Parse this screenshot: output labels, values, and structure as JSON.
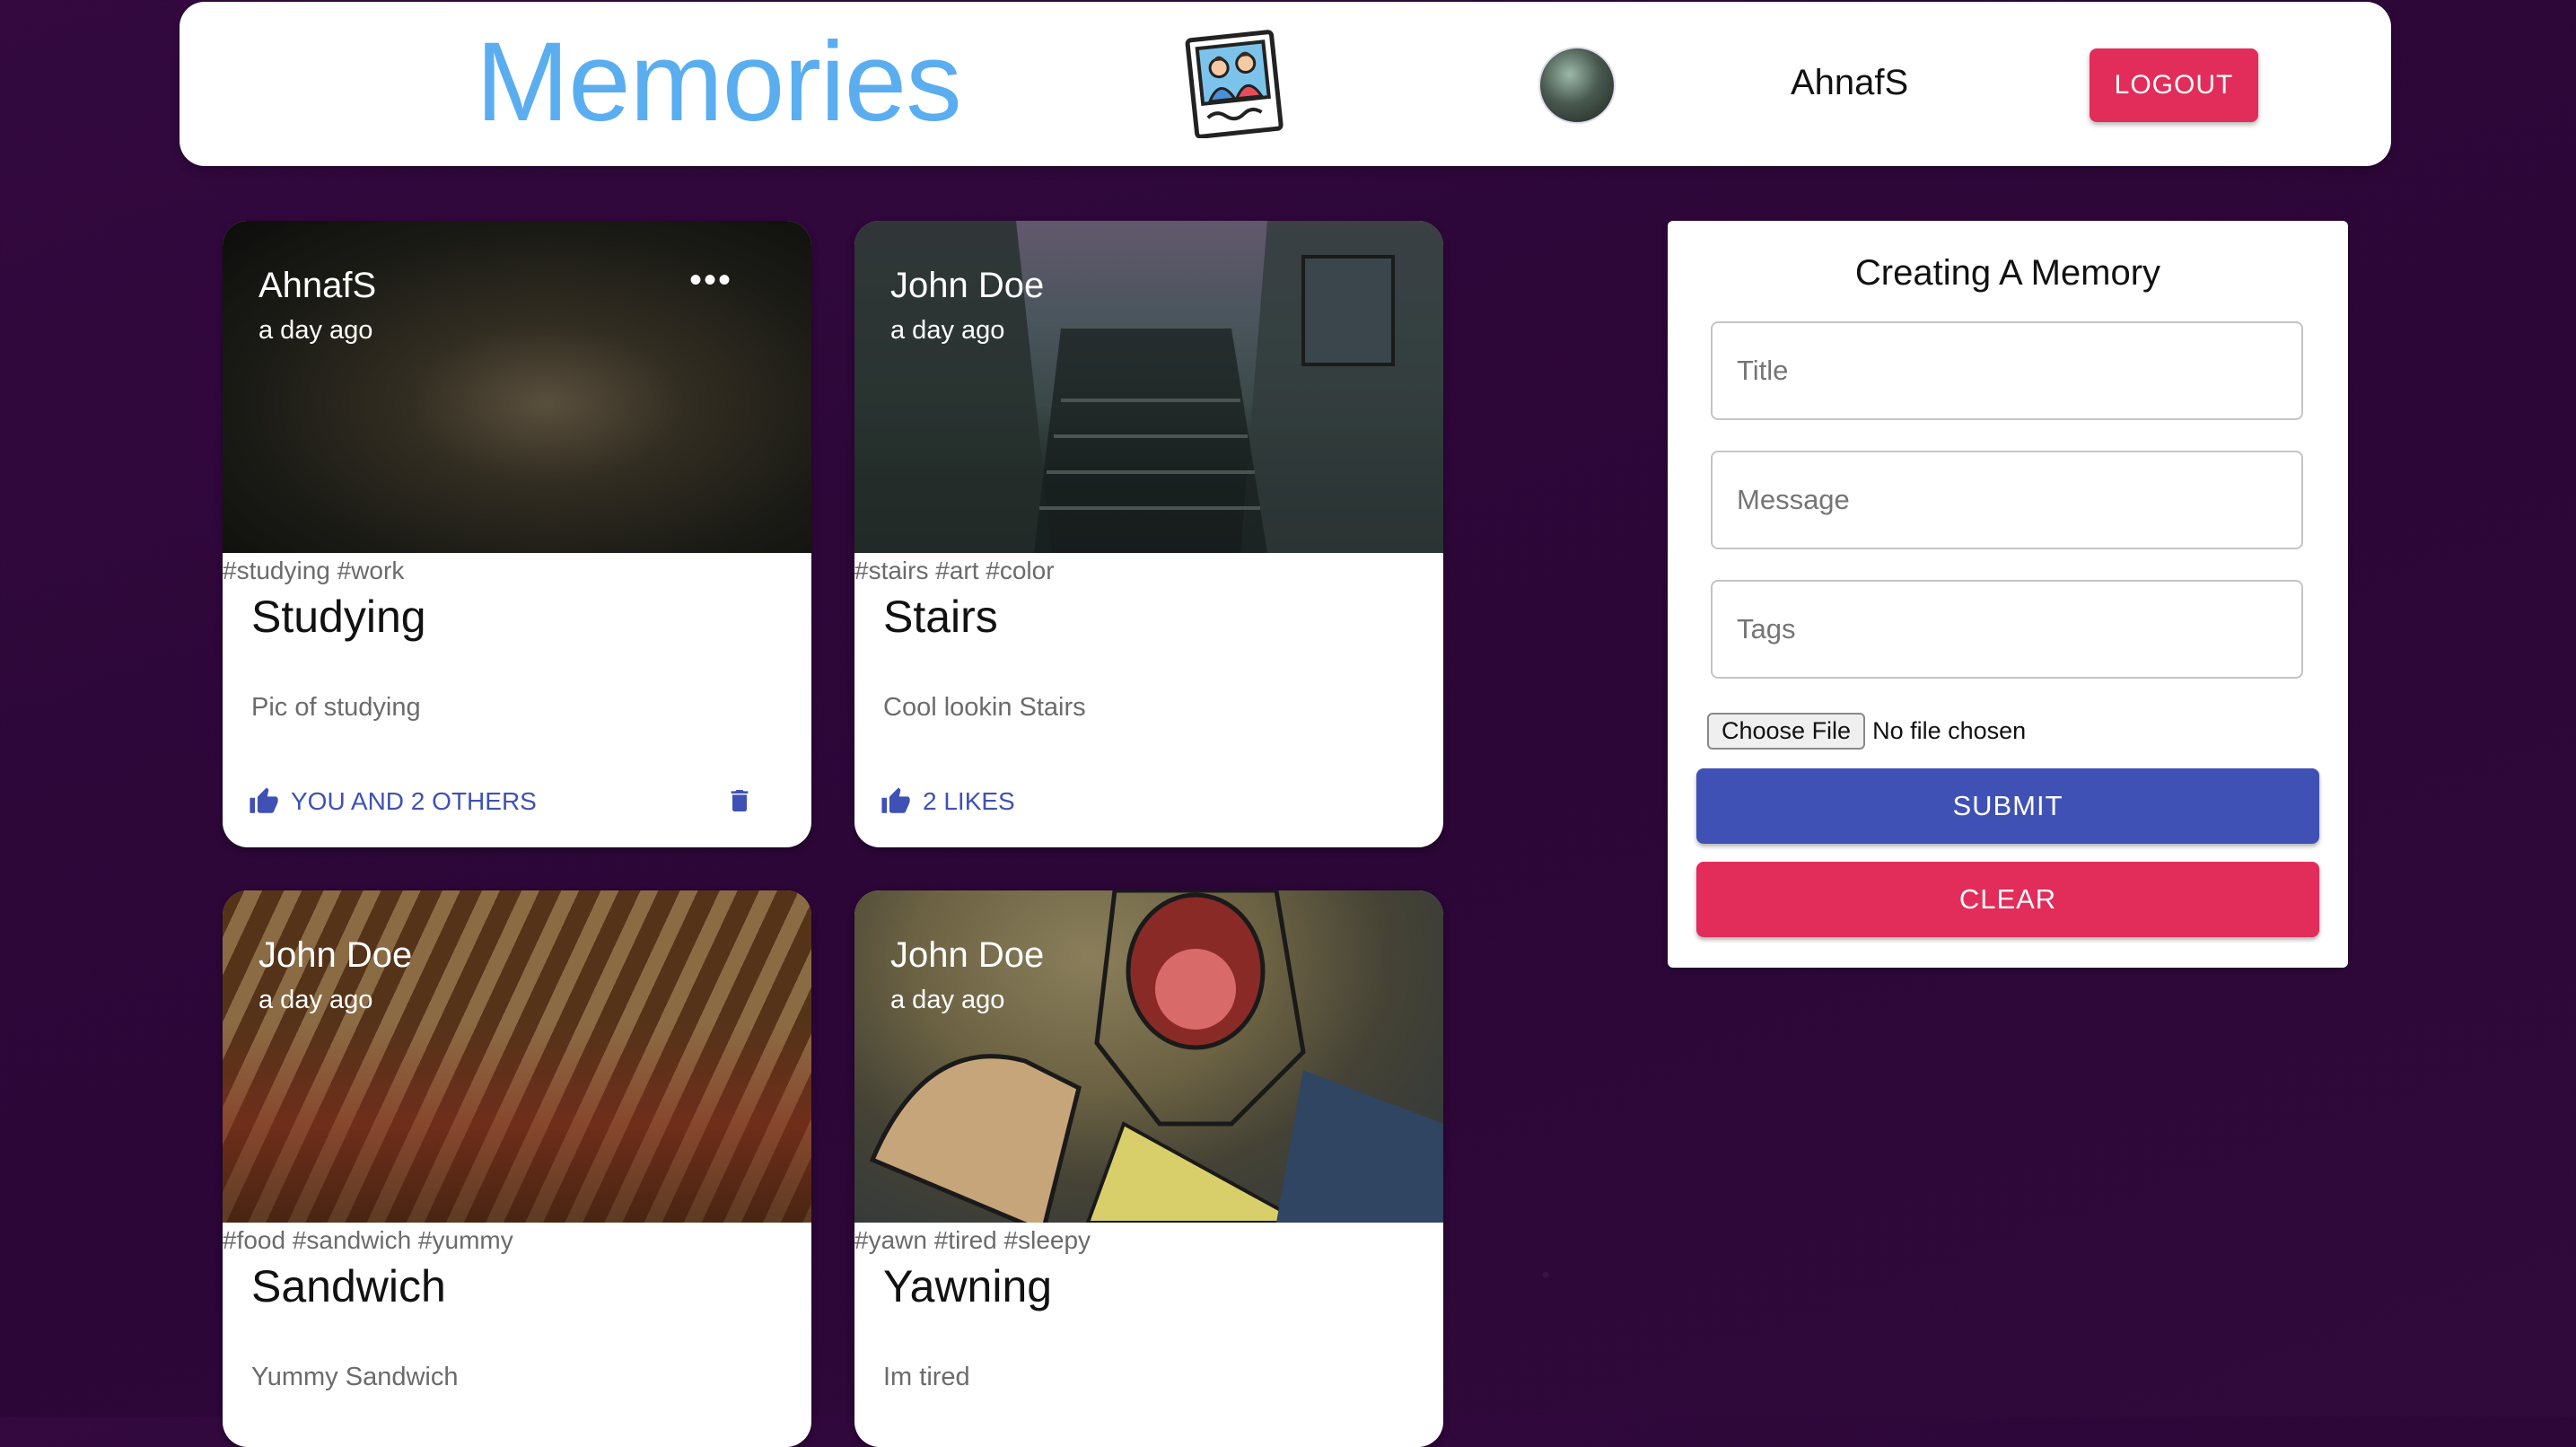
{
  "header": {
    "title": "Memories",
    "username": "AhnafS",
    "logout_label": "LOGOUT"
  },
  "posts": [
    {
      "author": "AhnafS",
      "time": "a day ago",
      "tags": "#studying #work",
      "title": "Studying",
      "message": "Pic of studying",
      "likes": "YOU AND 2 OTHERS",
      "has_menu": true,
      "has_delete": true
    },
    {
      "author": "John Doe",
      "time": "a day ago",
      "tags": "#stairs #art #color",
      "title": "Stairs",
      "message": "Cool lookin Stairs",
      "likes": "2 LIKES",
      "has_menu": false,
      "has_delete": false
    },
    {
      "author": "John Doe",
      "time": "a day ago",
      "tags": "#food #sandwich #yummy",
      "title": "Sandwich",
      "message": "Yummy Sandwich"
    },
    {
      "author": "John Doe",
      "time": "a day ago",
      "tags": "#yawn #tired #sleepy",
      "title": "Yawning",
      "message": "Im tired"
    }
  ],
  "form": {
    "heading": "Creating A Memory",
    "title_placeholder": "Title",
    "message_placeholder": "Message",
    "tags_placeholder": "Tags",
    "file_button": "Choose File",
    "file_status": "No file chosen",
    "submit_label": "SUBMIT",
    "clear_label": "CLEAR"
  },
  "colors": {
    "background": "#2d0838",
    "brand": "#5aaef0",
    "primary": "#3f51b5",
    "secondary": "#e22c59"
  },
  "icons": {
    "brand": "photo-memories-icon",
    "like": "thumb-up-icon",
    "delete": "trash-icon",
    "menu": "more-horizontal-icon"
  }
}
